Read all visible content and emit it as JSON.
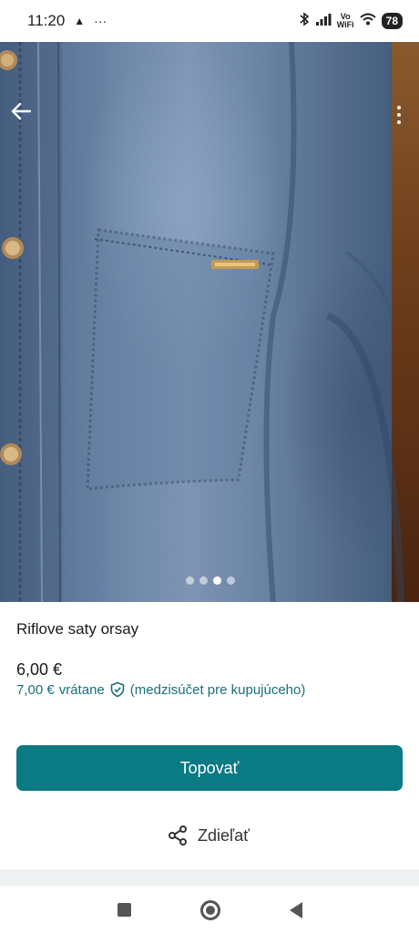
{
  "status_bar": {
    "time": "11:20",
    "extra": "···",
    "vowifi_top": "Vo",
    "vowifi_bottom": "WiFi",
    "battery": "78"
  },
  "gallery": {
    "page_count": 4,
    "active_index": 2
  },
  "product": {
    "title": "Riflove saty orsay",
    "price": "6,00 €",
    "price_incl_amount": "7,00 €",
    "price_incl_word": "vrátane",
    "price_incl_note": "(medzisúčet pre kupujúceho)"
  },
  "actions": {
    "primary_label": "Topovať",
    "share_label": "Zdieľať"
  },
  "colors": {
    "accent": "#0a7a83",
    "accent_text": "#17707a"
  },
  "icons": {
    "back": "arrow-left-icon",
    "more": "more-vertical-icon",
    "shield": "shield-check-icon",
    "share": "share-icon"
  }
}
